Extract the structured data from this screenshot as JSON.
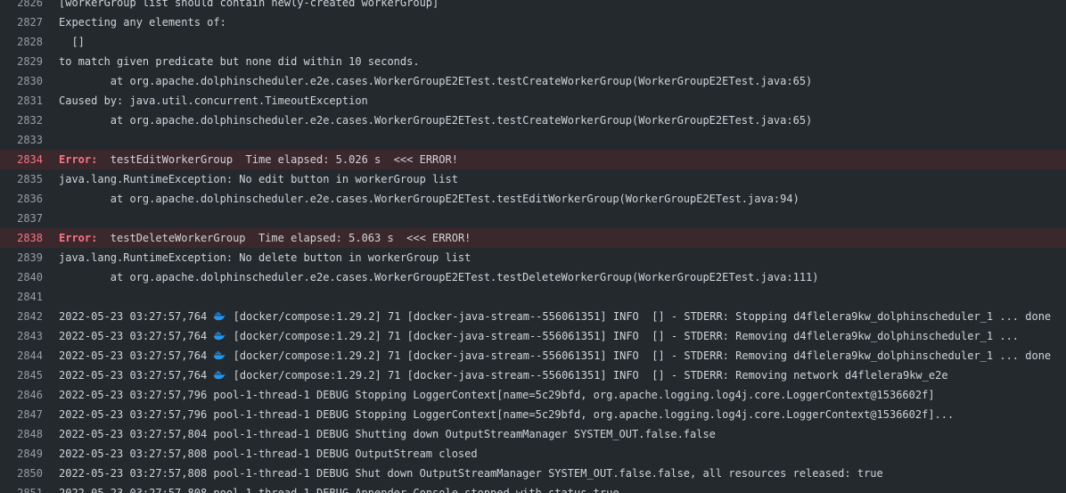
{
  "colors": {
    "background": "#24292e",
    "error_row_background": "#3a282c",
    "error_text": "#f97583",
    "line_number": "#959da5",
    "text": "#d1d5da",
    "whale_icon": "#2396ed"
  },
  "lines": [
    {
      "n": "2826",
      "text": "[workerGroup list should contain newly-created workerGroup]"
    },
    {
      "n": "2827",
      "text": "Expecting any elements of:"
    },
    {
      "n": "2828",
      "text": "  []"
    },
    {
      "n": "2829",
      "text": "to match given predicate but none did within 10 seconds."
    },
    {
      "n": "2830",
      "text": "        at org.apache.dolphinscheduler.e2e.cases.WorkerGroupE2ETest.testCreateWorkerGroup(WorkerGroupE2ETest.java:65)"
    },
    {
      "n": "2831",
      "text": "Caused by: java.util.concurrent.TimeoutException"
    },
    {
      "n": "2832",
      "text": "        at org.apache.dolphinscheduler.e2e.cases.WorkerGroupE2ETest.testCreateWorkerGroup(WorkerGroupE2ETest.java:65)"
    },
    {
      "n": "2833",
      "text": ""
    },
    {
      "n": "2834",
      "error": true,
      "label": "Error:",
      "text": "  testEditWorkerGroup  Time elapsed: 5.026 s  <<< ERROR!"
    },
    {
      "n": "2835",
      "text": "java.lang.RuntimeException: No edit button in workerGroup list"
    },
    {
      "n": "2836",
      "text": "        at org.apache.dolphinscheduler.e2e.cases.WorkerGroupE2ETest.testEditWorkerGroup(WorkerGroupE2ETest.java:94)"
    },
    {
      "n": "2837",
      "text": ""
    },
    {
      "n": "2838",
      "error": true,
      "label": "Error:",
      "text": "  testDeleteWorkerGroup  Time elapsed: 5.063 s  <<< ERROR!"
    },
    {
      "n": "2839",
      "text": "java.lang.RuntimeException: No delete button in workerGroup list"
    },
    {
      "n": "2840",
      "text": "        at org.apache.dolphinscheduler.e2e.cases.WorkerGroupE2ETest.testDeleteWorkerGroup(WorkerGroupE2ETest.java:111)"
    },
    {
      "n": "2841",
      "text": ""
    },
    {
      "n": "2842",
      "whale": true,
      "pre": "2022-05-23 03:27:57,764 ",
      "text": " [docker/compose:1.29.2] 71 [docker-java-stream--556061351] INFO  [] - STDERR: Stopping d4flelera9kw_dolphinscheduler_1 ... done"
    },
    {
      "n": "2843",
      "whale": true,
      "pre": "2022-05-23 03:27:57,764 ",
      "text": " [docker/compose:1.29.2] 71 [docker-java-stream--556061351] INFO  [] - STDERR: Removing d4flelera9kw_dolphinscheduler_1 ..."
    },
    {
      "n": "2844",
      "whale": true,
      "pre": "2022-05-23 03:27:57,764 ",
      "text": " [docker/compose:1.29.2] 71 [docker-java-stream--556061351] INFO  [] - STDERR: Removing d4flelera9kw_dolphinscheduler_1 ... done"
    },
    {
      "n": "2845",
      "whale": true,
      "pre": "2022-05-23 03:27:57,764 ",
      "text": " [docker/compose:1.29.2] 71 [docker-java-stream--556061351] INFO  [] - STDERR: Removing network d4flelera9kw_e2e"
    },
    {
      "n": "2846",
      "text": "2022-05-23 03:27:57,796 pool-1-thread-1 DEBUG Stopping LoggerContext[name=5c29bfd, org.apache.logging.log4j.core.LoggerContext@1536602f]"
    },
    {
      "n": "2847",
      "text": "2022-05-23 03:27:57,796 pool-1-thread-1 DEBUG Stopping LoggerContext[name=5c29bfd, org.apache.logging.log4j.core.LoggerContext@1536602f]..."
    },
    {
      "n": "2848",
      "text": "2022-05-23 03:27:57,804 pool-1-thread-1 DEBUG Shutting down OutputStreamManager SYSTEM_OUT.false.false"
    },
    {
      "n": "2849",
      "text": "2022-05-23 03:27:57,808 pool-1-thread-1 DEBUG OutputStream closed"
    },
    {
      "n": "2850",
      "text": "2022-05-23 03:27:57,808 pool-1-thread-1 DEBUG Shut down OutputStreamManager SYSTEM_OUT.false.false, all resources released: true"
    },
    {
      "n": "2851",
      "text": "2022-05-23 03:27:57,808 pool-1-thread-1 DEBUG Appender Console stopped with status true"
    }
  ]
}
